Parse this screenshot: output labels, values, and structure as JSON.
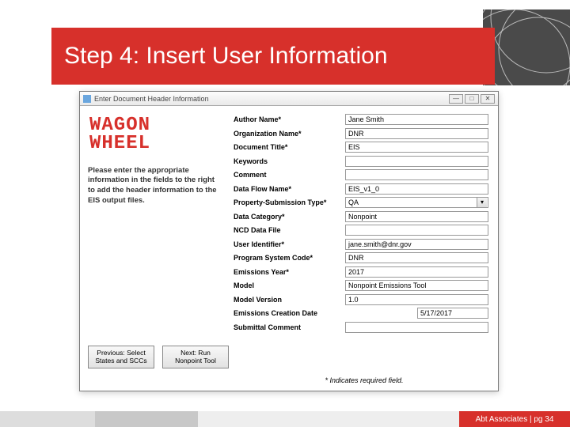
{
  "slide": {
    "title": "Step 4: Insert User Information",
    "footer": "Abt Associates | pg 34"
  },
  "dialog": {
    "window_title": "Enter Document Header Information",
    "logo": "WAGON\nWHEEL",
    "instructions": "Please enter the appropriate information in the fields to the right to add the header information to the EIS output files.",
    "buttons": {
      "prev": "Previous: Select States and SCCs",
      "next": "Next: Run Nonpoint Tool"
    },
    "required_note": "* Indicates required field.",
    "fields": [
      {
        "label": "Author Name*",
        "value": "Jane Smith",
        "type": "text"
      },
      {
        "label": "Organization Name*",
        "value": "DNR",
        "type": "text"
      },
      {
        "label": "Document Title*",
        "value": "EIS",
        "type": "text"
      },
      {
        "label": "Keywords",
        "value": "",
        "type": "text"
      },
      {
        "label": "Comment",
        "value": "",
        "type": "text"
      },
      {
        "label": "Data Flow Name*",
        "value": "EIS_v1_0",
        "type": "text"
      },
      {
        "label": "Property-Submission Type*",
        "value": "QA",
        "type": "select"
      },
      {
        "label": "Data Category*",
        "value": "Nonpoint",
        "type": "text"
      },
      {
        "label": "NCD Data File",
        "value": "",
        "type": "text"
      },
      {
        "label": "User Identifier*",
        "value": "jane.smith@dnr.gov",
        "type": "text"
      },
      {
        "label": "Program System Code*",
        "value": "DNR",
        "type": "text"
      },
      {
        "label": "Emissions Year*",
        "value": "2017",
        "type": "text"
      },
      {
        "label": "Model",
        "value": "Nonpoint Emissions Tool",
        "type": "text"
      },
      {
        "label": "Model Version",
        "value": "1.0",
        "type": "text"
      },
      {
        "label": "Emissions Creation Date",
        "value": "5/17/2017",
        "type": "date"
      },
      {
        "label": "Submittal Comment",
        "value": "",
        "type": "text"
      }
    ]
  }
}
